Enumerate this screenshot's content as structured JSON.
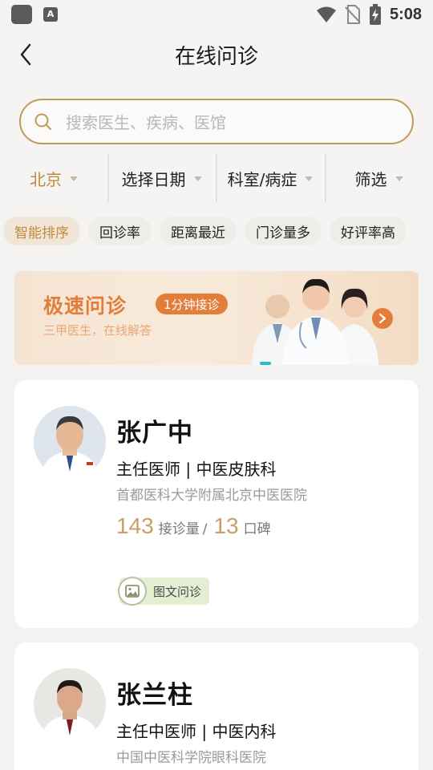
{
  "status_bar": {
    "time": "5:08",
    "a_badge": "A"
  },
  "header": {
    "title": "在线问诊"
  },
  "search": {
    "placeholder": "搜索医生、疾病、医馆"
  },
  "filters": [
    {
      "label": "北京",
      "active": true
    },
    {
      "label": "选择日期",
      "active": false
    },
    {
      "label": "科室/病症",
      "active": false
    },
    {
      "label": "筛选",
      "active": false
    }
  ],
  "sort_chips": [
    {
      "label": "智能排序",
      "active": true
    },
    {
      "label": "回诊率",
      "active": false
    },
    {
      "label": "距离最近",
      "active": false
    },
    {
      "label": "门诊量多",
      "active": false
    },
    {
      "label": "好评率高",
      "active": false
    }
  ],
  "banner": {
    "title": "极速问诊",
    "tag": "1分钟接诊",
    "subtitle": "三甲医生，在线解答"
  },
  "doctors": [
    {
      "name": "张广中",
      "title": "主任医师 | 中医皮肤科",
      "hospital": "首都医科大学附属北京中医医院",
      "consult_count": "143",
      "consult_label": "接诊量",
      "reputation": "13",
      "reputation_label": "口碑",
      "service": "图文问诊"
    },
    {
      "name": "张兰柱",
      "title": "主任中医师 | 中医内科",
      "hospital": "中国中医科学院眼科医院"
    }
  ],
  "colors": {
    "accent": "#c0893a",
    "banner_orange": "#e27d3a",
    "stat_gold": "#c9a064",
    "service_bg": "#e5edd3"
  }
}
